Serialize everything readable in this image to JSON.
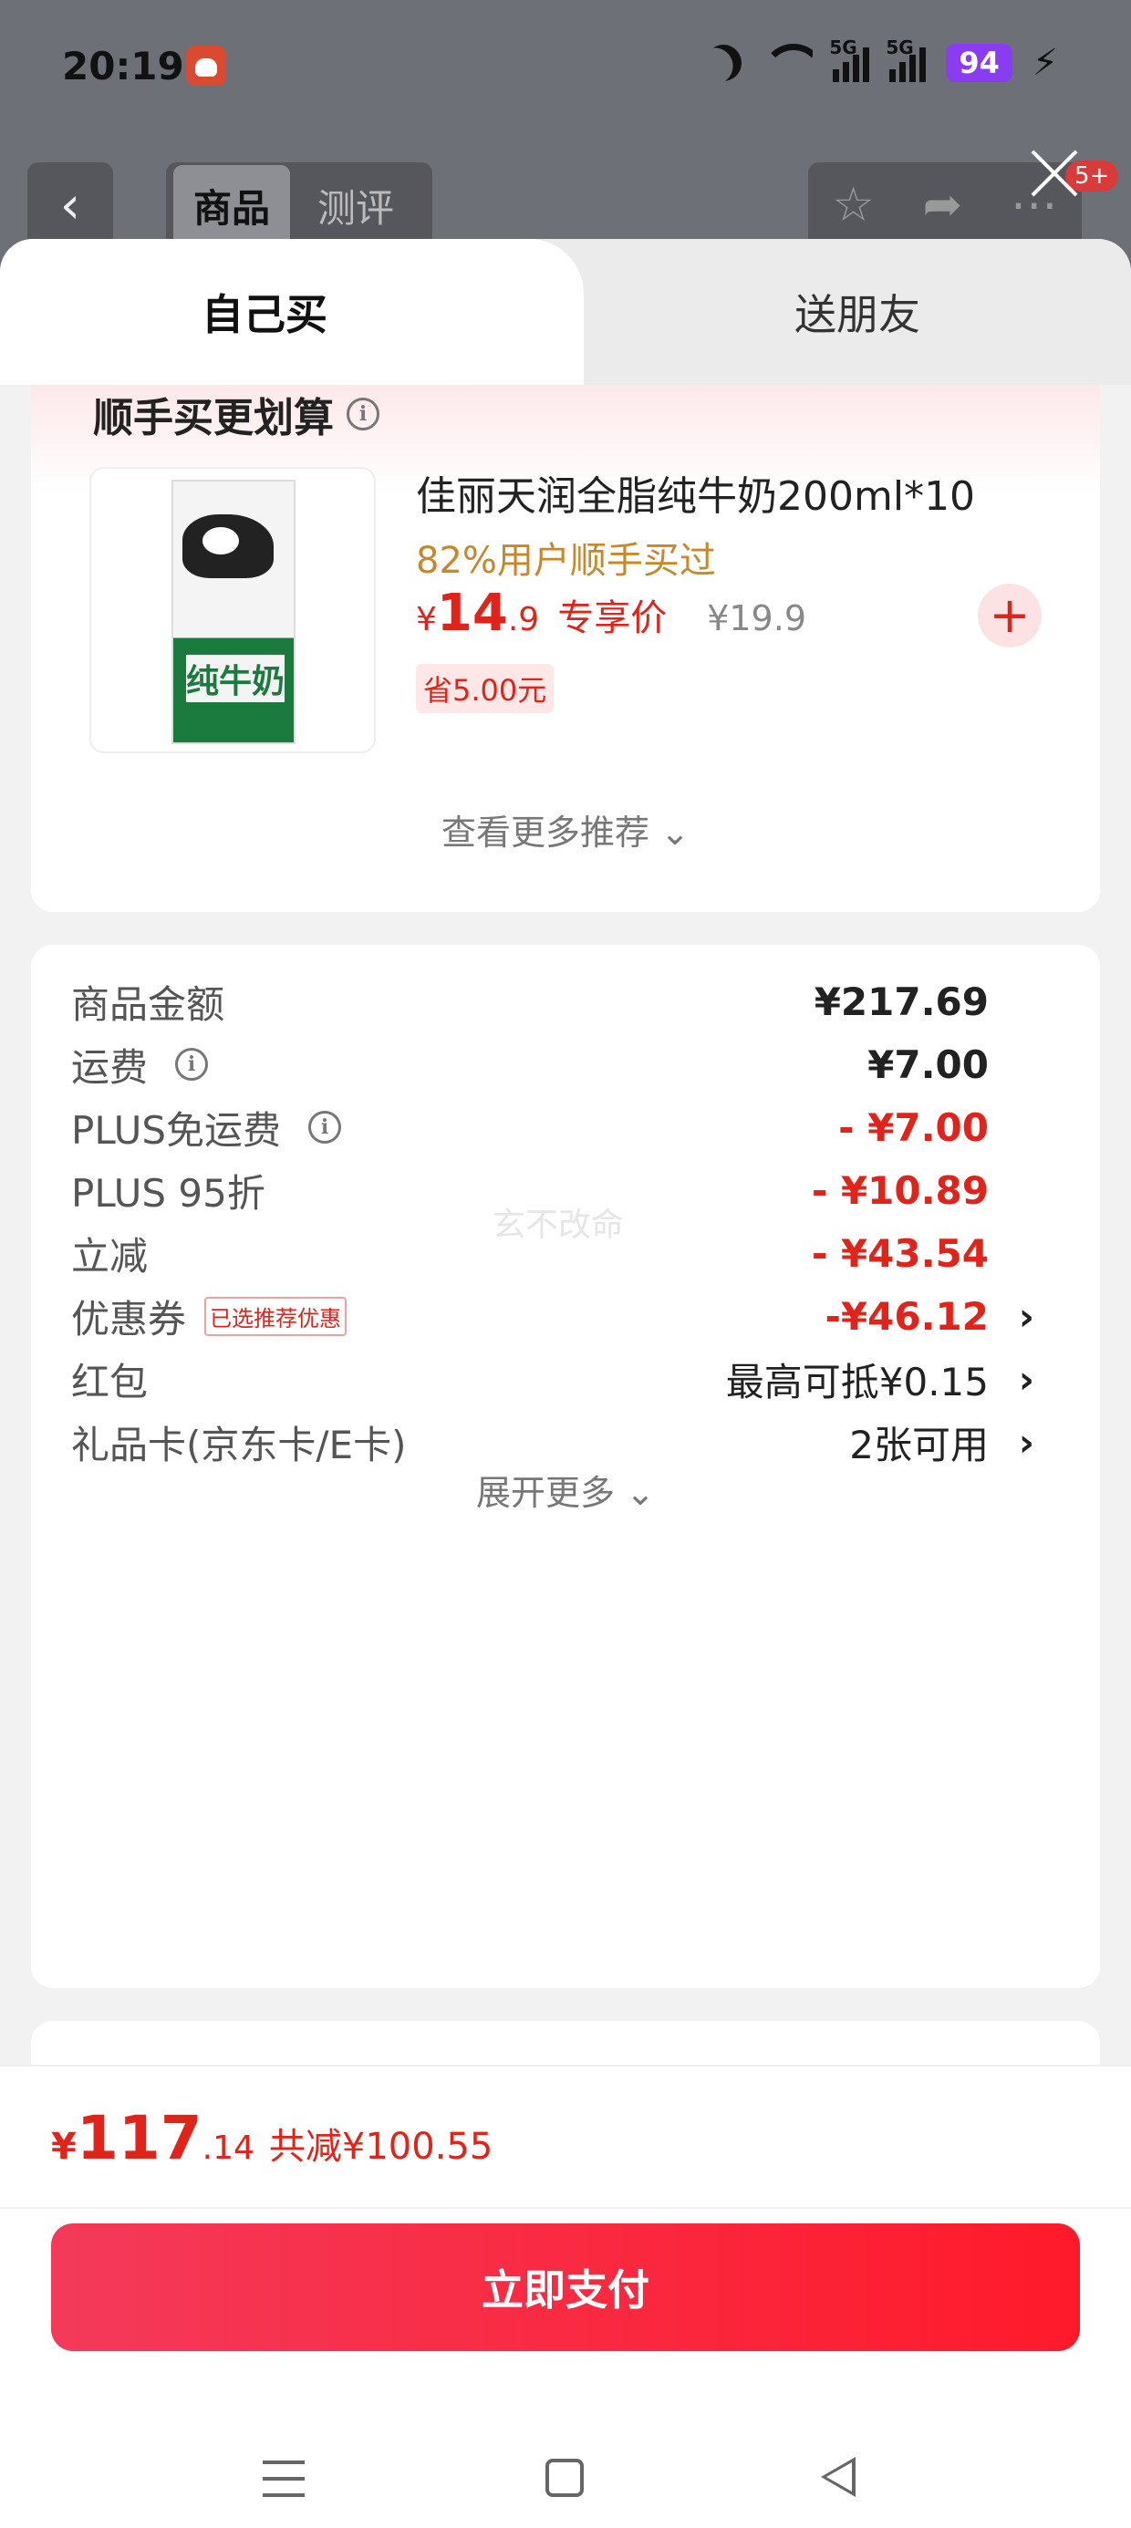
{
  "status_bar": {
    "time": "20:19",
    "battery": "94",
    "network": "5G"
  },
  "nav": {
    "back_icon": "‹",
    "tabs": [
      "商品",
      "测评"
    ],
    "badge": "5+"
  },
  "sheet_tabs": {
    "self": "自己买",
    "friend": "送朋友"
  },
  "recommend": {
    "title": "顺手买更划算",
    "product_name": "佳丽天润全脂纯牛奶200ml*10",
    "subtitle": "82%用户顺手买过",
    "currency": "¥",
    "price_int": "14",
    "price_dec": ".9",
    "exclusive_label": "专享价",
    "original_price": "¥19.9",
    "save_tag": "省5.00元",
    "add_icon": "+",
    "image_text": "纯牛奶",
    "more_label": "查看更多推荐 ⌄"
  },
  "summary": {
    "rows": [
      {
        "label": "商品金额",
        "value": "¥217.69"
      },
      {
        "label": "运费",
        "value": "¥7.00"
      },
      {
        "label": "PLUS免运费",
        "value": "- ¥7.00"
      },
      {
        "label": "PLUS 95折",
        "value": "- ¥10.89"
      },
      {
        "label": "立减",
        "value": "- ¥43.54"
      },
      {
        "label": "优惠券",
        "tag": "已选推荐优惠",
        "value": "-¥46.12"
      },
      {
        "label": "红包",
        "value": "最高可抵¥0.15"
      },
      {
        "label": "礼品卡(京东卡/E卡)",
        "value": "2张可用"
      }
    ],
    "expand_label": "展开更多 ⌄",
    "watermark": "玄不改命"
  },
  "bottom": {
    "currency": "¥",
    "total_int": "117",
    "total_dec": ".14",
    "saved": "共减¥100.55",
    "pay_label": "立即支付"
  },
  "colors": {
    "accent": "#e2231a",
    "pay_gradient_start": "#f43a5a",
    "pay_gradient_end": "#ff1a2a",
    "sub_orange": "#c8882a"
  }
}
